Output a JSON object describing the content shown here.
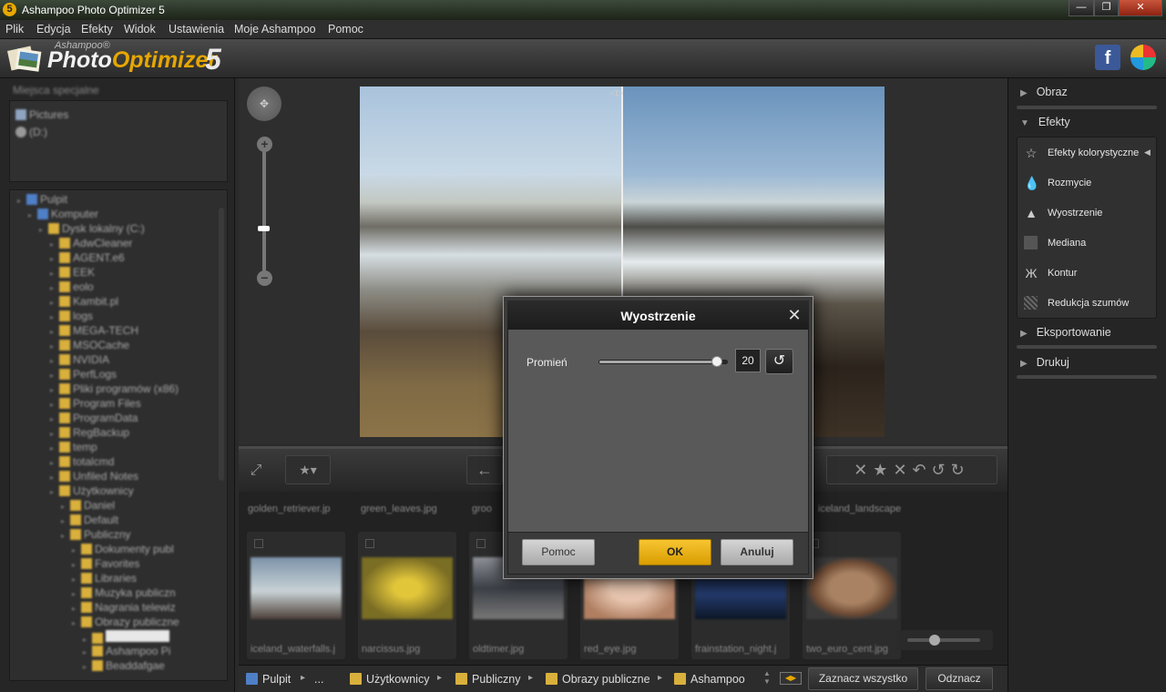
{
  "window": {
    "title": "Ashampoo Photo Optimizer 5",
    "app_icon": "5",
    "min": "—",
    "restore": "❐",
    "close": "✕"
  },
  "menu": [
    "Plik",
    "Edycja",
    "Efekty",
    "Widok",
    "Ustawienia",
    "Moje Ashampoo",
    "Pomoc"
  ],
  "logo": {
    "brand": "Ashampoo®",
    "name_a": "Photo",
    "name_b": "Optimizer",
    "version": "5"
  },
  "places": {
    "title": "Miejsca specjalne",
    "items": [
      "Pictures",
      "(D:)"
    ]
  },
  "tree": [
    {
      "label": "Pulpit",
      "depth": 0
    },
    {
      "label": "Komputer",
      "depth": 1
    },
    {
      "label": "Dysk lokalny (C:)",
      "depth": 2
    },
    {
      "label": "AdwCleaner",
      "depth": 3
    },
    {
      "label": "AGENT.e6",
      "depth": 3
    },
    {
      "label": "EEK",
      "depth": 3
    },
    {
      "label": "eolo",
      "depth": 3
    },
    {
      "label": "Kambit.pl",
      "depth": 3
    },
    {
      "label": "logs",
      "depth": 3
    },
    {
      "label": "MEGA-TECH",
      "depth": 3
    },
    {
      "label": "MSOCache",
      "depth": 3
    },
    {
      "label": "NVIDIA",
      "depth": 3
    },
    {
      "label": "PerfLogs",
      "depth": 3
    },
    {
      "label": "Pliki programów (x86)",
      "depth": 3
    },
    {
      "label": "Program Files",
      "depth": 3
    },
    {
      "label": "ProgramData",
      "depth": 3
    },
    {
      "label": "RegBackup",
      "depth": 3
    },
    {
      "label": "temp",
      "depth": 3
    },
    {
      "label": "totalcmd",
      "depth": 3
    },
    {
      "label": "Unfiled Notes",
      "depth": 3
    },
    {
      "label": "Użytkownicy",
      "depth": 3
    },
    {
      "label": "Daniel",
      "depth": 4
    },
    {
      "label": "Default",
      "depth": 4
    },
    {
      "label": "Publiczny",
      "depth": 4
    },
    {
      "label": "Dokumenty publ",
      "depth": 5
    },
    {
      "label": "Favorites",
      "depth": 5
    },
    {
      "label": "Libraries",
      "depth": 5
    },
    {
      "label": "Muzyka publiczn",
      "depth": 5
    },
    {
      "label": "Nagrania telewiz",
      "depth": 5
    },
    {
      "label": "Obrazy publiczne",
      "depth": 5
    },
    {
      "label": "",
      "depth": 6
    },
    {
      "label": "Ashampoo Pi",
      "depth": 6
    },
    {
      "label": "Beaddafgae",
      "depth": 6
    }
  ],
  "thumbnails": {
    "top_names": [
      "golden_retriever.jp",
      "green_leaves.jpg",
      "groo",
      "",
      "",
      "",
      "iceland_landscape.j"
    ],
    "cards": [
      {
        "name": "iceland_waterfalls.j",
        "color_a": "#7c93a9",
        "color_b": "#c9d2d6"
      },
      {
        "name": "narcissus.jpg",
        "color_a": "#8a7a2c",
        "color_b": "#c8b23a"
      },
      {
        "name": "oldtimer.jpg",
        "color_a": "#3b3f46",
        "color_b": "#8f9399"
      },
      {
        "name": "red_eye.jpg",
        "color_a": "#b07f62",
        "color_b": "#e8c6b0"
      },
      {
        "name": "frainstation_night.j",
        "color_a": "#0c1627",
        "color_b": "#243a6b"
      },
      {
        "name": "two_euro_cent.jpg",
        "color_a": "#6e4a33",
        "color_b": "#a88262"
      }
    ]
  },
  "breadcrumb": [
    "Pulpit",
    "...",
    "Użytkownicy",
    "Publiczny",
    "Obrazy publiczne",
    "Ashampoo"
  ],
  "bottom_buttons": {
    "select_all": "Zaznacz wszystko",
    "deselect": "Odznacz"
  },
  "right_panel": {
    "sections": [
      "Obraz",
      "Efekty",
      "Eksportowanie",
      "Drukuj"
    ],
    "effects": [
      {
        "label": "Efekty kolorystyczne",
        "icon": "star-icon"
      },
      {
        "label": "Rozmycie",
        "icon": "drop-icon"
      },
      {
        "label": "Wyostrzenie",
        "icon": "triangle-icon"
      },
      {
        "label": "Mediana",
        "icon": "median-icon"
      },
      {
        "label": "Kontur",
        "icon": "butterfly-icon"
      },
      {
        "label": "Redukcja szumów",
        "icon": "noise-icon"
      }
    ]
  },
  "dialog": {
    "title": "Wyostrzenie",
    "radius_label": "Promień",
    "radius_value": "20",
    "radius_fraction": 0.93,
    "help": "Pomoc",
    "ok": "OK",
    "cancel": "Anuluj"
  },
  "colors": {
    "accent": "#e6a700",
    "facebook": "#3b5998"
  }
}
